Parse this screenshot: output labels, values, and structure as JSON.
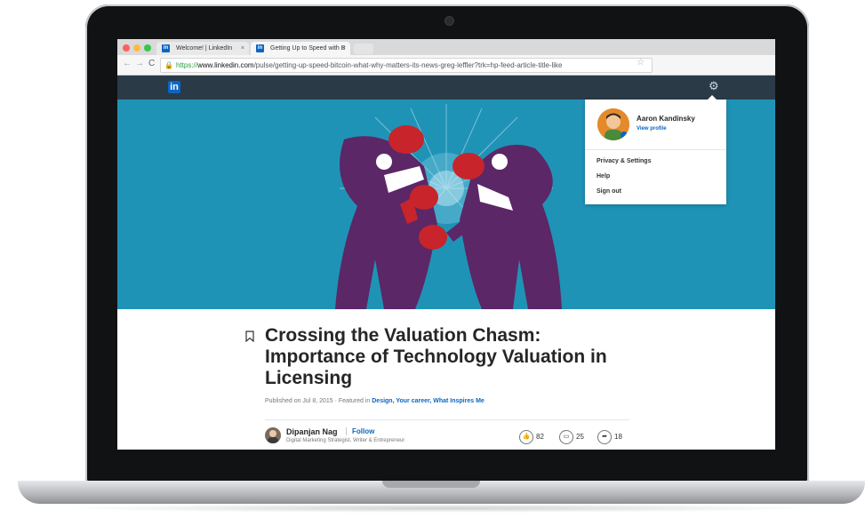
{
  "browser": {
    "tabs": [
      {
        "label": "Welcome! | LinkedIn",
        "close": "×"
      },
      {
        "label": "Getting Up to Speed with B",
        "close": "×"
      }
    ],
    "url": {
      "scheme": "https://",
      "host": "www.linkedin.com",
      "path": "/pulse/getting-up-speed-bitcoin-what-why-matters-its-news-greg-leffler?trk=hp-feed-article-title-like"
    },
    "traffic_colors": [
      "#fc605b",
      "#fdbc40",
      "#34c84a"
    ]
  },
  "header": {
    "logo": "in",
    "icons": [
      "settings-gear-icon"
    ]
  },
  "profile_menu": {
    "name": "Aaron Kandinsky",
    "view_profile": "View profile",
    "items": [
      "Privacy & Settings",
      "Help",
      "Sign out"
    ]
  },
  "article": {
    "title": "Crossing the Valuation Chasm: Importance of Technology Valuation in Licensing",
    "published": "Published on Jul 8, 2015 · Featured in ",
    "tags": "Design, Your career, What Inspires Me",
    "author": {
      "name": "Dipanjan Nag",
      "follow": "Follow",
      "headline": "Digital Marketing Strategist, Writer & Entrepreneur"
    },
    "stats": {
      "likes": "82",
      "comments": "25",
      "shares": "18"
    }
  },
  "colors": {
    "linkedin_blue": "#0a66c2",
    "header_bg": "#2b3a47",
    "hero_bg": "#1f93b6",
    "suit_purple": "#5b2766",
    "glove_red": "#c8242b"
  }
}
